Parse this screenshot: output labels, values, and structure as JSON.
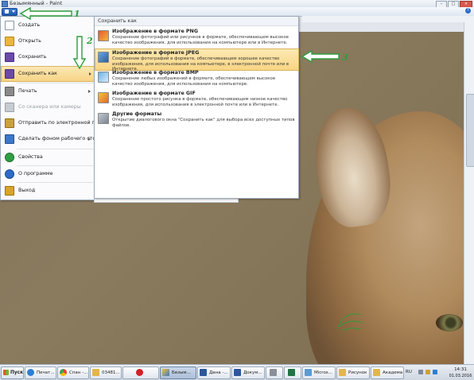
{
  "window": {
    "title": "Безымянный - Paint",
    "controls": [
      "–",
      "□",
      "×"
    ]
  },
  "ribbon": {
    "help_glyph": "?"
  },
  "app_menu": {
    "items": [
      {
        "label": "Создать",
        "icon": "new-file-icon",
        "color": "#ffffff"
      },
      {
        "label": "Открыть",
        "icon": "open-folder-icon",
        "color": "#e8b73c"
      },
      {
        "label": "Сохранить",
        "icon": "save-icon",
        "color": "#6b4aa8"
      },
      {
        "label": "Сохранить как",
        "icon": "save-as-icon",
        "color": "#6b4aa8"
      },
      {
        "label": "Печать",
        "icon": "print-icon",
        "color": "#7a7a7a"
      },
      {
        "label": "Со сканера или камеры",
        "icon": "scanner-icon",
        "color": "#9aa0a8"
      },
      {
        "label": "Отправить по электронной почте",
        "icon": "email-icon",
        "color": "#c9a33a"
      },
      {
        "label": "Сделать фоном рабочего стола",
        "icon": "desktop-bg-icon",
        "color": "#3c78c7"
      },
      {
        "label": "Свойства",
        "icon": "properties-icon",
        "color": "#2f9e44"
      },
      {
        "label": "О программе",
        "icon": "about-icon",
        "color": "#2e6bc6"
      },
      {
        "label": "Выход",
        "icon": "exit-icon",
        "color": "#d6a52a"
      }
    ]
  },
  "save_as_menu": {
    "header": "Сохранить как",
    "items": [
      {
        "title": "Изображение в формате PNG",
        "description": "Сохранение фотографий или рисунков в формате, обеспечивающем высокое качество изображения, для использования на компьютере или в Интернете.",
        "icon": "png-icon"
      },
      {
        "title": "Изображение в формате JPEG",
        "description": "Сохранение фотографий в формате, обеспечивающем хорошее качество изображения, для использования на компьютере, в электронной почте или в Интернете.",
        "icon": "jpeg-icon"
      },
      {
        "title": "Изображение в формате BMP",
        "description": "Сохранение любых изображений в формате, обеспечивающем высокое качество изображения, для использования на компьютере.",
        "icon": "bmp-icon"
      },
      {
        "title": "Изображение в формате GIF",
        "description": "Сохранение простого рисунка в формате, обеспечивающем низкое качество изображения, для использования в электронной почте или в Интернете.",
        "icon": "gif-icon"
      },
      {
        "title": "Другие форматы",
        "description": "Открытие диалогового окна \"Сохранить как\" для выбора всех доступных типов файлов.",
        "icon": "other-formats-icon"
      }
    ]
  },
  "annotations": {
    "num1": "1",
    "num2": "2",
    "num3": "3",
    "color": "#2c9e3c"
  },
  "taskbar": {
    "start_label": "Пуск",
    "buttons": [
      {
        "label": "Печат...",
        "icon": "ie-icon"
      },
      {
        "label": "Спан -...",
        "icon": "chrome-icon"
      },
      {
        "label": "03481...",
        "icon": "folder-icon"
      },
      {
        "label": "",
        "icon": "opera-icon"
      },
      {
        "label": "Безым...",
        "icon": "paint-icon"
      },
      {
        "label": "Дана -...",
        "icon": "word-icon"
      },
      {
        "label": "Докум...",
        "icon": "word-icon"
      },
      {
        "label": "",
        "icon": "calculator-icon"
      },
      {
        "label": "",
        "icon": "excel-icon"
      },
      {
        "label": "Micros...",
        "icon": "window-icon"
      },
      {
        "label": "Рисунок",
        "icon": "folder-icon"
      },
      {
        "label": "Академа",
        "icon": "folder-icon"
      }
    ],
    "tray": {
      "language": "RU",
      "time": "14:31",
      "date": "01.03.2016"
    }
  }
}
